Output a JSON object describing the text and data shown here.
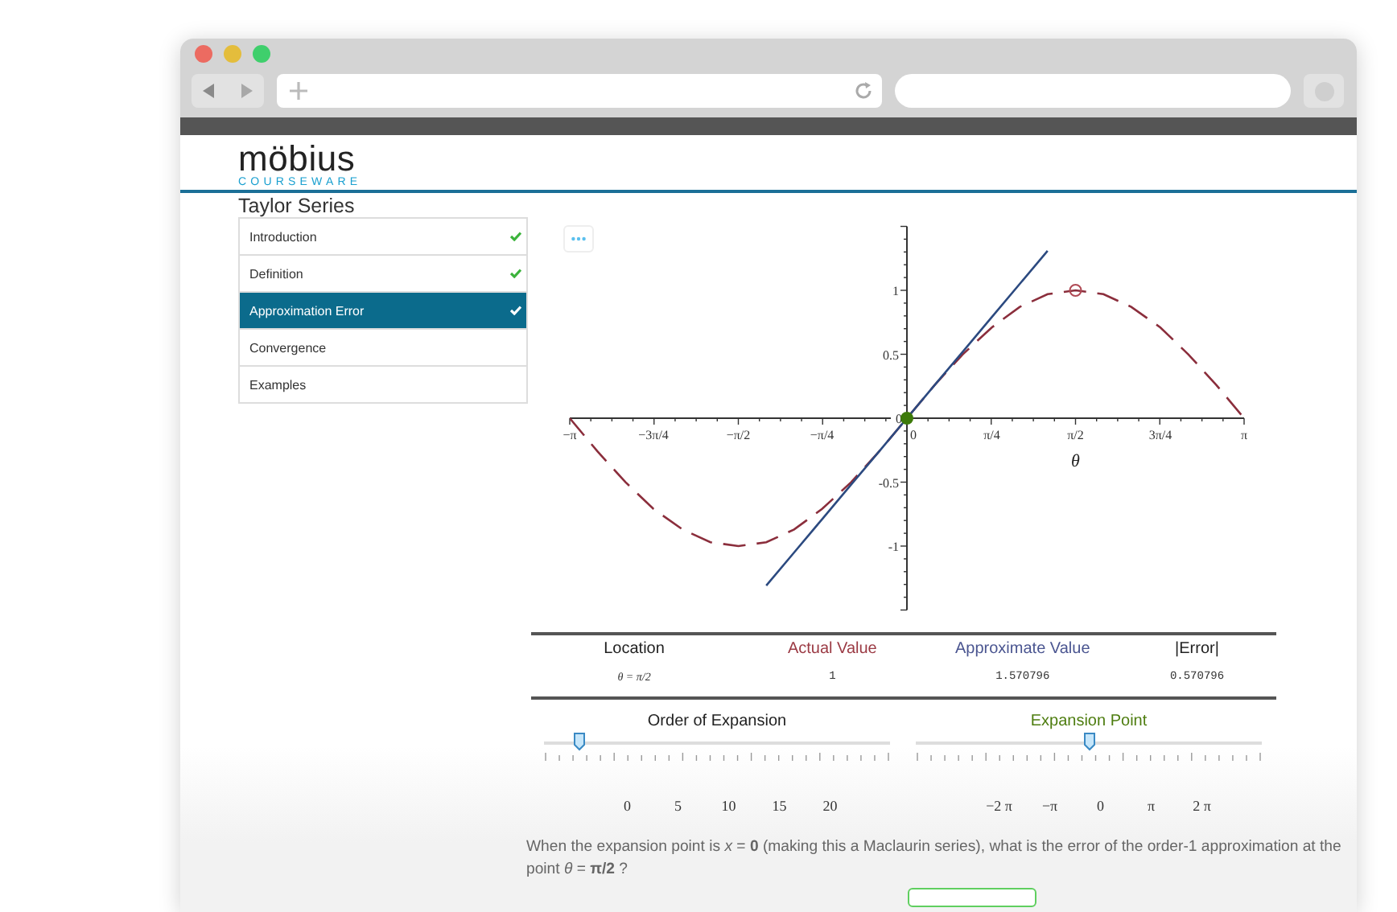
{
  "logo": {
    "name": "möbius",
    "tagline": "COURSEWARE"
  },
  "page_title": "Taylor Series",
  "sidebar": {
    "items": [
      {
        "label": "Introduction",
        "selected": false,
        "completed": true
      },
      {
        "label": "Definition",
        "selected": false,
        "completed": true
      },
      {
        "label": "Approximation Error",
        "selected": true,
        "completed": true
      },
      {
        "label": "Convergence",
        "selected": false,
        "completed": false
      },
      {
        "label": "Examples",
        "selected": false,
        "completed": false
      }
    ]
  },
  "plot": {
    "chart_data": {
      "type": "line",
      "xlabel": "θ",
      "x": [
        -3.14,
        -2.88,
        -2.62,
        -2.36,
        -2.09,
        -1.83,
        -1.57,
        -1.31,
        -1.05,
        -0.79,
        -0.52,
        -0.26,
        0,
        0.26,
        0.52,
        0.79,
        1.05,
        1.31,
        1.57,
        1.83,
        2.09,
        2.36,
        2.62,
        2.88,
        3.14
      ],
      "series": [
        {
          "color": "#8b2e3c",
          "line_style": "dashed",
          "values": [
            0,
            -0.26,
            -0.5,
            -0.71,
            -0.87,
            -0.97,
            -1,
            -0.97,
            -0.87,
            -0.71,
            -0.5,
            -0.26,
            0,
            0.26,
            0.5,
            0.71,
            0.87,
            0.97,
            1,
            0.97,
            0.87,
            0.71,
            0.5,
            0.26,
            0
          ]
        },
        {
          "color": "#2c4a80",
          "line_style": "solid",
          "values": [
            null,
            null,
            null,
            null,
            null,
            null,
            null,
            -1.31,
            -1.05,
            -0.79,
            -0.52,
            -0.26,
            0,
            0.26,
            0.52,
            0.79,
            1.05,
            1.31,
            null,
            null,
            null,
            null,
            null,
            null,
            null
          ]
        }
      ],
      "xlim": [
        -3.14,
        3.14
      ],
      "ylim": [
        -1.5,
        1.5
      ],
      "xticks": [
        {
          "value": -3.14,
          "label": "−π"
        },
        {
          "value": -2.36,
          "label": "−3π/4"
        },
        {
          "value": -1.57,
          "label": "−π/2"
        },
        {
          "value": -0.79,
          "label": "−π/4"
        },
        {
          "value": 0,
          "label": "0"
        },
        {
          "value": 0.79,
          "label": "π/4"
        },
        {
          "value": 1.57,
          "label": "π/2"
        },
        {
          "value": 2.36,
          "label": "3π/4"
        },
        {
          "value": 3.14,
          "label": "π"
        }
      ],
      "yticks": [
        {
          "value": 1,
          "label": "1"
        },
        {
          "value": 0.5,
          "label": "0.5"
        },
        {
          "value": 0,
          "label": "0"
        },
        {
          "value": -0.5,
          "label": "-0.5"
        },
        {
          "value": -1,
          "label": "-1"
        }
      ]
    }
  },
  "table": {
    "columns": [
      {
        "label": "Location",
        "color": "#222222"
      },
      {
        "label": "Actual Value",
        "color": "#9b3a44"
      },
      {
        "label": "Approximate Value",
        "color": "#4a5590"
      },
      {
        "label": "|Error|",
        "color": "#222222"
      }
    ],
    "rows": [
      [
        "θ = π/2",
        "1",
        "1.570796",
        "0.570796"
      ]
    ]
  },
  "sliders": [
    {
      "title": "Order of Expansion",
      "color": "#222222",
      "level": 0.1,
      "labels": [
        "0",
        "5",
        "10",
        "15",
        "20"
      ]
    },
    {
      "title": "Expansion Point",
      "color": "#4e7d10",
      "level": 0.5,
      "labels": [
        "−2 π",
        "−π",
        "0",
        "π",
        "2 π"
      ]
    }
  ],
  "question": "When the expansion point is *x* = **0** (making this a Maclaurin series), what is the error of the order-1 approximation at the point *θ* = **π/2** ?"
}
